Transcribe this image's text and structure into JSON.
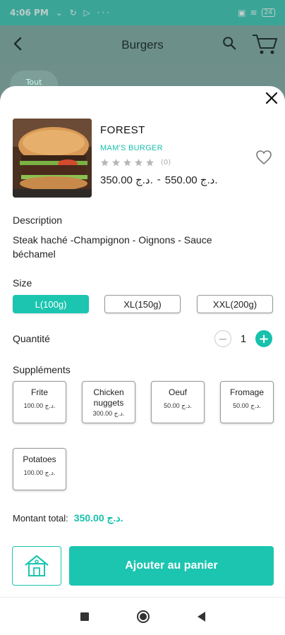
{
  "status_bar": {
    "time": "4:06 PM",
    "battery": "24"
  },
  "header": {
    "title": "Burgers",
    "chip_label": "Tout"
  },
  "product": {
    "name": "FOREST",
    "brand": "MAM'S BURGER",
    "rating": 0,
    "rating_count": "(0)",
    "price_new": "350.00 د.ج.",
    "price_separator": "-",
    "price_old": "550.00 د.ج."
  },
  "description": {
    "label": "Description",
    "text": "Steak haché -Champignon - Oignons - Sauce béchamel"
  },
  "size": {
    "label": "Size",
    "options": [
      {
        "label": "L(100g)",
        "selected": true
      },
      {
        "label": "XL(150g)",
        "selected": false
      },
      {
        "label": "XXL(200g)",
        "selected": false
      }
    ]
  },
  "quantity": {
    "label": "Quantité",
    "value": "1"
  },
  "supplements": {
    "label": "Suppléments",
    "items": [
      {
        "name": "Frite",
        "price": "100.00 د.ج."
      },
      {
        "name": "Chicken nuggets",
        "price": "300.00 د.ج."
      },
      {
        "name": "Oeuf",
        "price": "50.00 د.ج."
      },
      {
        "name": "Fromage",
        "price": "50.00 د.ج."
      },
      {
        "name": "Potatoes",
        "price": "100.00 د.ج."
      }
    ]
  },
  "total": {
    "label": "Montant total:",
    "value": "350.00 د.ج."
  },
  "actions": {
    "add_to_cart": "Ajouter au panier"
  },
  "colors": {
    "accent": "#1cc5b0",
    "accent_text": "#17c1ac"
  },
  "icons": [
    "back-arrow-icon",
    "search-icon",
    "cart-icon",
    "close-icon",
    "heart-icon",
    "star-icon",
    "minus-icon",
    "plus-icon",
    "house-icon"
  ]
}
